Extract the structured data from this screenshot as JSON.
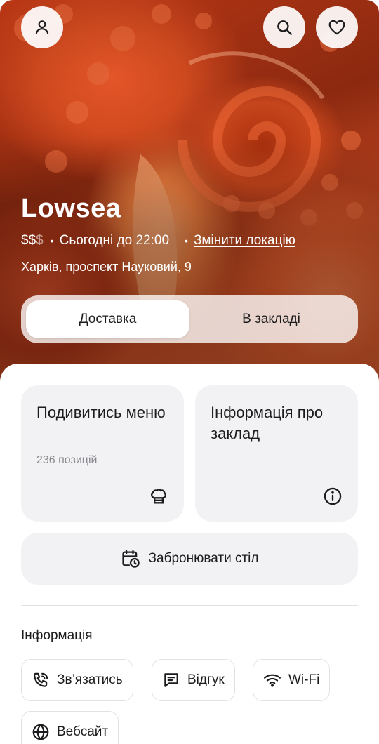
{
  "header": {
    "profile_icon": "user-icon",
    "search_icon": "search-icon",
    "favorite_icon": "heart-icon"
  },
  "restaurant": {
    "name": "Lowsea",
    "price_active": "$$",
    "price_inactive": "$",
    "hours": "Сьогодні до 22:00",
    "change_location": "Змінити локацію",
    "address": "Харків, проспект Науковий, 9"
  },
  "mode_toggle": {
    "options": [
      {
        "label": "Доставка",
        "selected": true
      },
      {
        "label": "В закладі",
        "selected": false
      }
    ]
  },
  "cards": {
    "menu": {
      "title": "Подивитись меню",
      "subtitle": "236 позицій",
      "icon": "chef-hat-icon"
    },
    "info": {
      "title": "Інформація про заклад",
      "icon": "info-icon"
    }
  },
  "book_table": {
    "label": "Забронювати стіл",
    "icon": "calendar-clock-icon"
  },
  "info_section": {
    "title": "Інформація",
    "chips": [
      {
        "label": "Зв’язатись",
        "icon": "phone-call-icon"
      },
      {
        "label": "Відгук",
        "icon": "message-icon"
      },
      {
        "label": "Wi-Fi",
        "icon": "wifi-icon"
      },
      {
        "label": "Вебсайт",
        "icon": "globe-icon"
      }
    ]
  },
  "colors": {
    "hero_accent": "#c9461c",
    "card_bg": "#f2f2f5",
    "text": "#1c1c1e",
    "muted": "#8a8a8e"
  }
}
